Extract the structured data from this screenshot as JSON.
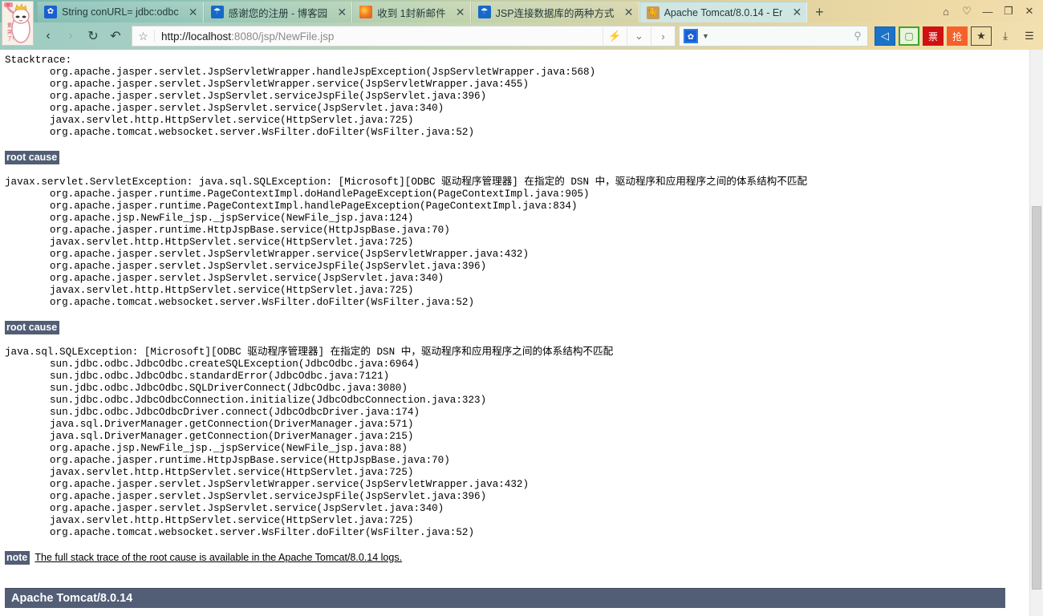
{
  "browser": {
    "avatar_alt": "cartoon-avatar",
    "tabs": [
      {
        "favicon": "paw-icon",
        "title": "String conURL= jdbc:odbc",
        "close": "✕",
        "active": false
      },
      {
        "favicon": "blog-icon",
        "title": "感谢您的注册 - 博客园",
        "close": "✕",
        "active": false
      },
      {
        "favicon": "mail-icon",
        "title": "收到 1封新邮件",
        "close": "✕",
        "active": false
      },
      {
        "favicon": "blog-icon",
        "title": "JSP连接数据库的两种方式",
        "close": "✕",
        "active": false
      },
      {
        "favicon": "tomcat-icon",
        "title": "Apache Tomcat/8.0.14 - Er",
        "close": "✕",
        "active": true
      }
    ],
    "new_tab_label": "+",
    "window_controls": [
      {
        "name": "bag-icon",
        "glyph": "⌂"
      },
      {
        "name": "shirt-icon",
        "glyph": "♡"
      },
      {
        "name": "minimize-icon",
        "glyph": "—"
      },
      {
        "name": "maximize-icon",
        "glyph": "❐"
      },
      {
        "name": "close-icon",
        "glyph": "✕"
      }
    ],
    "nav": {
      "back": "‹",
      "forward": "›",
      "reload": "↻",
      "home": "↶"
    },
    "address": {
      "star": "☆",
      "url_host": "http://localhost",
      "url_rest": ":8080/jsp/NewFile.jsp",
      "extra_buttons": [
        {
          "name": "lightning-icon",
          "glyph": "⚡"
        },
        {
          "name": "chevron-down-icon",
          "glyph": "⌄"
        },
        {
          "name": "chevron-right-icon",
          "glyph": "›"
        }
      ]
    },
    "search": {
      "engine_icon": "baidu-paw-icon",
      "engine_glyph": "✿",
      "caret": "▼",
      "placeholder": "",
      "value": "",
      "magnifier": "⚲"
    },
    "toolbar_icons": [
      {
        "name": "speaker-icon",
        "glyph": "◁",
        "cls": "ic-blue"
      },
      {
        "name": "crop-icon",
        "glyph": "▢",
        "cls": "ic-green"
      },
      {
        "name": "ticket-icon",
        "glyph": "票",
        "cls": "ic-red"
      },
      {
        "name": "grab-icon",
        "glyph": "抢",
        "cls": "ic-orange"
      },
      {
        "name": "favorites-icon",
        "glyph": "★",
        "cls": "ic-star"
      },
      {
        "name": "download-icon",
        "glyph": "⤓",
        "cls": ""
      },
      {
        "name": "menu-icon",
        "glyph": "☰",
        "cls": ""
      }
    ]
  },
  "page": {
    "stacktrace_heading": "Stacktrace:",
    "stacktrace_frames": [
      "org.apache.jasper.servlet.JspServletWrapper.handleJspException(JspServletWrapper.java:568)",
      "org.apache.jasper.servlet.JspServletWrapper.service(JspServletWrapper.java:455)",
      "org.apache.jasper.servlet.JspServlet.serviceJspFile(JspServlet.java:396)",
      "org.apache.jasper.servlet.JspServlet.service(JspServlet.java:340)",
      "javax.servlet.http.HttpServlet.service(HttpServlet.java:725)",
      "org.apache.tomcat.websocket.server.WsFilter.doFilter(WsFilter.java:52)"
    ],
    "root_cause_1": {
      "heading": "root cause",
      "message": "javax.servlet.ServletException: java.sql.SQLException: [Microsoft][ODBC 驱动程序管理器] 在指定的 DSN 中，驱动程序和应用程序之间的体系结构不匹配",
      "frames": [
        "org.apache.jasper.runtime.PageContextImpl.doHandlePageException(PageContextImpl.java:905)",
        "org.apache.jasper.runtime.PageContextImpl.handlePageException(PageContextImpl.java:834)",
        "org.apache.jsp.NewFile_jsp._jspService(NewFile_jsp.java:124)",
        "org.apache.jasper.runtime.HttpJspBase.service(HttpJspBase.java:70)",
        "javax.servlet.http.HttpServlet.service(HttpServlet.java:725)",
        "org.apache.jasper.servlet.JspServletWrapper.service(JspServletWrapper.java:432)",
        "org.apache.jasper.servlet.JspServlet.serviceJspFile(JspServlet.java:396)",
        "org.apache.jasper.servlet.JspServlet.service(JspServlet.java:340)",
        "javax.servlet.http.HttpServlet.service(HttpServlet.java:725)",
        "org.apache.tomcat.websocket.server.WsFilter.doFilter(WsFilter.java:52)"
      ]
    },
    "root_cause_2": {
      "heading": "root cause",
      "message": "java.sql.SQLException: [Microsoft][ODBC 驱动程序管理器] 在指定的 DSN 中，驱动程序和应用程序之间的体系结构不匹配",
      "frames": [
        "sun.jdbc.odbc.JdbcOdbc.createSQLException(JdbcOdbc.java:6964)",
        "sun.jdbc.odbc.JdbcOdbc.standardError(JdbcOdbc.java:7121)",
        "sun.jdbc.odbc.JdbcOdbc.SQLDriverConnect(JdbcOdbc.java:3080)",
        "sun.jdbc.odbc.JdbcOdbcConnection.initialize(JdbcOdbcConnection.java:323)",
        "sun.jdbc.odbc.JdbcOdbcDriver.connect(JdbcOdbcDriver.java:174)",
        "java.sql.DriverManager.getConnection(DriverManager.java:571)",
        "java.sql.DriverManager.getConnection(DriverManager.java:215)",
        "org.apache.jsp.NewFile_jsp._jspService(NewFile_jsp.java:88)",
        "org.apache.jasper.runtime.HttpJspBase.service(HttpJspBase.java:70)",
        "javax.servlet.http.HttpServlet.service(HttpServlet.java:725)",
        "org.apache.jasper.servlet.JspServletWrapper.service(JspServletWrapper.java:432)",
        "org.apache.jasper.servlet.JspServlet.serviceJspFile(JspServlet.java:396)",
        "org.apache.jasper.servlet.JspServlet.service(JspServlet.java:340)",
        "javax.servlet.http.HttpServlet.service(HttpServlet.java:725)",
        "org.apache.tomcat.websocket.server.WsFilter.doFilter(WsFilter.java:52)"
      ]
    },
    "note": {
      "tag": "note",
      "text": "The full stack trace of the root cause is available in the Apache Tomcat/8.0.14 logs."
    },
    "footer": "Apache Tomcat/8.0.14"
  },
  "colors": {
    "header_bg": "#525e75",
    "page_bg": "#ffffff",
    "text": "#000000"
  }
}
